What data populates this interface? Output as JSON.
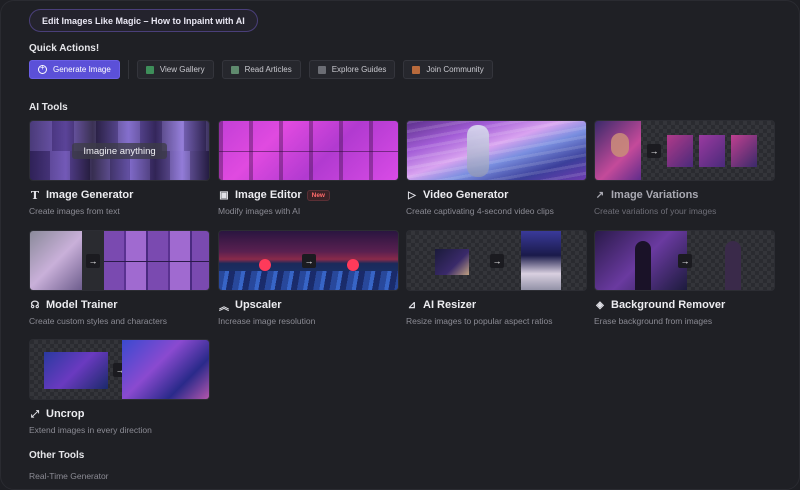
{
  "banner": {
    "label": "Edit Images Like Magic – How to Inpaint with AI"
  },
  "quick_actions": {
    "title": "Quick Actions!",
    "buttons": [
      {
        "label": "Generate Image",
        "icon": "plus-circle-icon",
        "primary": true
      },
      {
        "label": "View Gallery",
        "icon": "gallery-icon",
        "color": "#3e8e5a"
      },
      {
        "label": "Read Articles",
        "icon": "articles-icon",
        "color": "#5f8a6e"
      },
      {
        "label": "Explore Guides",
        "icon": "guides-icon",
        "color": "#6b6d74"
      },
      {
        "label": "Join Community",
        "icon": "community-icon",
        "color": "#b86a3c"
      }
    ]
  },
  "ai_tools": {
    "title": "AI Tools",
    "overlay_text": "Imagine anything",
    "new_badge": "New",
    "cards": [
      {
        "title": "Image Generator",
        "subtitle": "Create images from text",
        "icon": "text-icon"
      },
      {
        "title": "Image Editor",
        "subtitle": "Modify images with AI",
        "icon": "image-edit-icon"
      },
      {
        "title": "Video Generator",
        "subtitle": "Create captivating 4-second video clips",
        "icon": "play-icon"
      },
      {
        "title": "Image Variations",
        "subtitle": "Create variations of your images",
        "icon": "variations-icon"
      },
      {
        "title": "Model Trainer",
        "subtitle": "Create custom styles and characters",
        "icon": "brain-icon"
      },
      {
        "title": "Upscaler",
        "subtitle": "Increase image resolution",
        "icon": "chevrons-up-icon"
      },
      {
        "title": "AI Resizer",
        "subtitle": "Resize images to popular aspect ratios",
        "icon": "resize-icon"
      },
      {
        "title": "Background Remover",
        "subtitle": "Erase background from images",
        "icon": "layers-icon"
      },
      {
        "title": "Uncrop",
        "subtitle": "Extend images in every direction",
        "icon": "expand-icon"
      }
    ]
  },
  "other_tools": {
    "title": "Other Tools",
    "items": [
      {
        "label": "Real-Time Generator"
      }
    ]
  }
}
